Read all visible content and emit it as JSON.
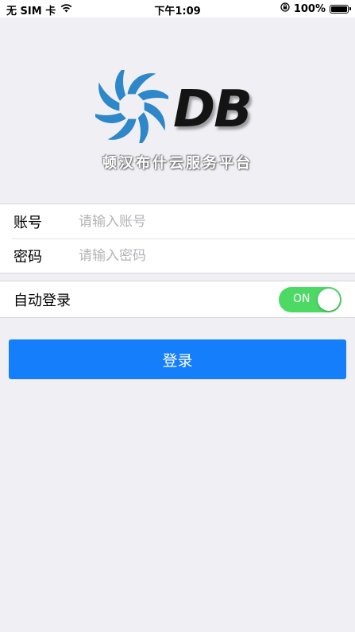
{
  "status_bar": {
    "carrier": "无 SIM 卡",
    "time": "下午1:09",
    "battery": "100%",
    "wifi_icon": "wifi-icon",
    "lock_icon": "orientation-lock-icon"
  },
  "logo": {
    "text": "DB",
    "subtitle": "顿汉布什云服务平台",
    "mark_icon": "turbine-logo-icon",
    "colors": {
      "blue": "#2d87c8",
      "dark": "#141414"
    }
  },
  "form": {
    "account_label": "账号",
    "account_placeholder": "请输入账号",
    "account_value": "",
    "password_label": "密码",
    "password_placeholder": "请输入密码",
    "password_value": ""
  },
  "auto_login": {
    "label": "自动登录",
    "toggle_text": "ON",
    "enabled": true
  },
  "login_button": {
    "label": "登录"
  },
  "colors": {
    "background": "#efeff4",
    "accent": "#147efb",
    "toggle_on": "#4cd964"
  }
}
